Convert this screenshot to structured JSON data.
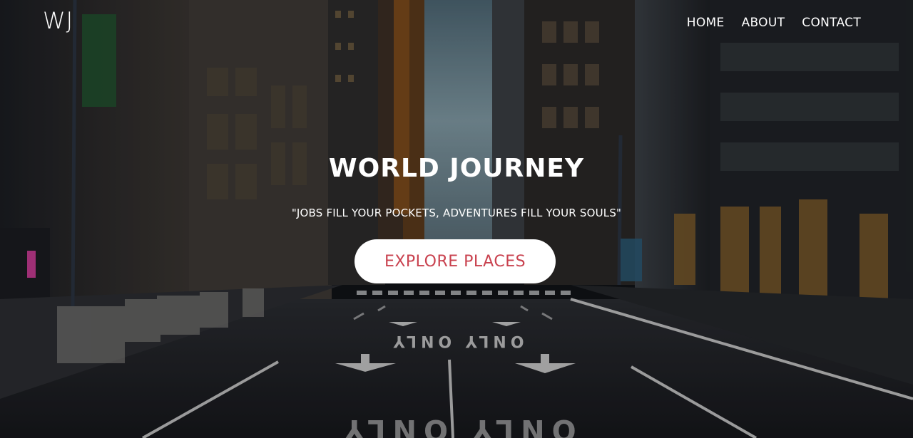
{
  "brand": {
    "logo_text": "WJ"
  },
  "nav": {
    "items": [
      {
        "label": "HOME"
      },
      {
        "label": "ABOUT"
      },
      {
        "label": "CONTACT"
      }
    ]
  },
  "hero": {
    "title": "WORLD JOURNEY",
    "tagline": "\"JOBS FILL YOUR POCKETS, ADVENTURES FILL YOUR SOULS\"",
    "cta_label": "EXPLORE PLACES",
    "road_marking": "ONLY ONLY"
  },
  "colors": {
    "accent": "#c9424f",
    "text": "#ffffff",
    "button_bg": "#ffffff"
  }
}
